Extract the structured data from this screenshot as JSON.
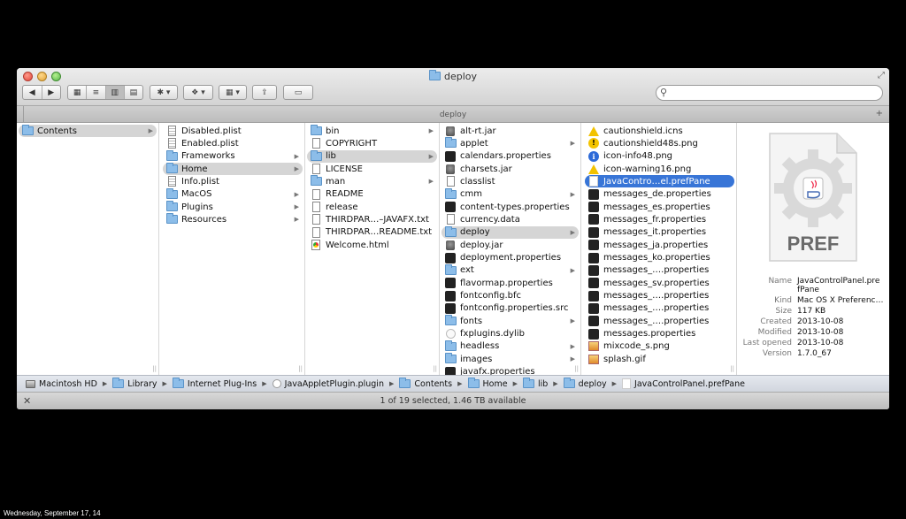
{
  "window": {
    "title": "deploy",
    "tab_label": "deploy",
    "status": "1 of 19 selected, 1.46 TB available"
  },
  "toolbar": {
    "back_label": "◀",
    "forward_label": "▶",
    "view_icons": "▦",
    "view_list": "≡",
    "view_columns": "▥",
    "view_coverflow": "▤",
    "action_label": "✱ ▾",
    "dropbox_label": "❖ ▾",
    "arrange_label": "▦ ▾",
    "share_label": "⇪",
    "toggle_label": "▭",
    "search_placeholder": ""
  },
  "columns": [
    {
      "items": [
        {
          "name": "Contents",
          "icon": "folder",
          "arrow": true,
          "state": "gray"
        }
      ]
    },
    {
      "items": [
        {
          "name": "Disabled.plist",
          "icon": "plist",
          "arrow": false
        },
        {
          "name": "Enabled.plist",
          "icon": "plist",
          "arrow": false
        },
        {
          "name": "Frameworks",
          "icon": "folder",
          "arrow": true
        },
        {
          "name": "Home",
          "icon": "folder",
          "arrow": true,
          "state": "gray"
        },
        {
          "name": "Info.plist",
          "icon": "plist",
          "arrow": false
        },
        {
          "name": "MacOS",
          "icon": "folder",
          "arrow": true
        },
        {
          "name": "Plugins",
          "icon": "folder",
          "arrow": true
        },
        {
          "name": "Resources",
          "icon": "folder",
          "arrow": true
        }
      ]
    },
    {
      "items": [
        {
          "name": "bin",
          "icon": "folder",
          "arrow": true
        },
        {
          "name": "COPYRIGHT",
          "icon": "doc",
          "arrow": false
        },
        {
          "name": "lib",
          "icon": "folder",
          "arrow": true,
          "state": "gray"
        },
        {
          "name": "LICENSE",
          "icon": "doc",
          "arrow": false
        },
        {
          "name": "man",
          "icon": "folder",
          "arrow": true
        },
        {
          "name": "README",
          "icon": "doc",
          "arrow": false
        },
        {
          "name": "release",
          "icon": "doc",
          "arrow": false
        },
        {
          "name": "THIRDPAR…–JAVAFX.txt",
          "icon": "doc",
          "arrow": false
        },
        {
          "name": "THIRDPAR…README.txt",
          "icon": "doc",
          "arrow": false
        },
        {
          "name": "Welcome.html",
          "icon": "html",
          "arrow": false
        }
      ]
    },
    {
      "items": [
        {
          "name": "alt-rt.jar",
          "icon": "jar",
          "arrow": false
        },
        {
          "name": "applet",
          "icon": "folder",
          "arrow": true
        },
        {
          "name": "calendars.properties",
          "icon": "exec",
          "arrow": false
        },
        {
          "name": "charsets.jar",
          "icon": "jar",
          "arrow": false
        },
        {
          "name": "classlist",
          "icon": "doc",
          "arrow": false
        },
        {
          "name": "cmm",
          "icon": "folder",
          "arrow": true
        },
        {
          "name": "content-types.properties",
          "icon": "exec",
          "arrow": false
        },
        {
          "name": "currency.data",
          "icon": "doc",
          "arrow": false
        },
        {
          "name": "deploy",
          "icon": "folder",
          "arrow": true,
          "state": "gray"
        },
        {
          "name": "deploy.jar",
          "icon": "jar",
          "arrow": false
        },
        {
          "name": "deployment.properties",
          "icon": "exec",
          "arrow": false
        },
        {
          "name": "ext",
          "icon": "folder",
          "arrow": true
        },
        {
          "name": "flavormap.properties",
          "icon": "exec",
          "arrow": false
        },
        {
          "name": "fontconfig.bfc",
          "icon": "exec",
          "arrow": false
        },
        {
          "name": "fontconfig.properties.src",
          "icon": "exec",
          "arrow": false
        },
        {
          "name": "fonts",
          "icon": "folder",
          "arrow": true
        },
        {
          "name": "fxplugins.dylib",
          "icon": "dylib",
          "arrow": false
        },
        {
          "name": "headless",
          "icon": "folder",
          "arrow": true
        },
        {
          "name": "images",
          "icon": "folder",
          "arrow": true
        },
        {
          "name": "javafx.properties",
          "icon": "exec",
          "arrow": false
        }
      ]
    },
    {
      "items": [
        {
          "name": "cautionshield.icns",
          "icon": "warn",
          "arrow": false
        },
        {
          "name": "cautionshield48s.png",
          "icon": "warny",
          "arrow": false
        },
        {
          "name": "icon-info48.png",
          "icon": "info",
          "arrow": false
        },
        {
          "name": "icon-warning16.png",
          "icon": "warn",
          "arrow": false
        },
        {
          "name": "JavaContro…el.prefPane",
          "icon": "pref",
          "arrow": false,
          "state": "blue"
        },
        {
          "name": "messages_de.properties",
          "icon": "exec",
          "arrow": false
        },
        {
          "name": "messages_es.properties",
          "icon": "exec",
          "arrow": false
        },
        {
          "name": "messages_fr.properties",
          "icon": "exec",
          "arrow": false
        },
        {
          "name": "messages_it.properties",
          "icon": "exec",
          "arrow": false
        },
        {
          "name": "messages_ja.properties",
          "icon": "exec",
          "arrow": false
        },
        {
          "name": "messages_ko.properties",
          "icon": "exec",
          "arrow": false
        },
        {
          "name": "messages_….properties",
          "icon": "exec",
          "arrow": false
        },
        {
          "name": "messages_sv.properties",
          "icon": "exec",
          "arrow": false
        },
        {
          "name": "messages_….properties",
          "icon": "exec",
          "arrow": false
        },
        {
          "name": "messages_….properties",
          "icon": "exec",
          "arrow": false
        },
        {
          "name": "messages_….properties",
          "icon": "exec",
          "arrow": false
        },
        {
          "name": "messages.properties",
          "icon": "exec",
          "arrow": false
        },
        {
          "name": "mixcode_s.png",
          "icon": "img",
          "arrow": false
        },
        {
          "name": "splash.gif",
          "icon": "img",
          "arrow": false
        }
      ]
    }
  ],
  "preview": {
    "badge_text": "PREF",
    "info": [
      {
        "key": "Name",
        "value": "JavaControlPanel.pre fPane"
      },
      {
        "key": "Kind",
        "value": "Mac OS X Preferenc…"
      },
      {
        "key": "Size",
        "value": "117 KB"
      },
      {
        "key": "Created",
        "value": "2013-10-08"
      },
      {
        "key": "Modified",
        "value": "2013-10-08"
      },
      {
        "key": "Last opened",
        "value": "2013-10-08"
      },
      {
        "key": "Version",
        "value": "1.7.0_67"
      }
    ]
  },
  "pathbar": [
    {
      "label": "Macintosh HD",
      "icon": "hd"
    },
    {
      "label": "Library",
      "icon": "folder"
    },
    {
      "label": "Internet Plug-Ins",
      "icon": "folder"
    },
    {
      "label": "JavaAppletPlugin.plugin",
      "icon": "plugin"
    },
    {
      "label": "Contents",
      "icon": "folder"
    },
    {
      "label": "Home",
      "icon": "folder"
    },
    {
      "label": "lib",
      "icon": "folder"
    },
    {
      "label": "deploy",
      "icon": "folder"
    },
    {
      "label": "JavaControlPanel.prefPane",
      "icon": "pref"
    }
  ],
  "caption": "Wednesday, September 17, 14",
  "colors": {
    "selection_blue": "#3875d7",
    "selection_gray": "#d5d5d5",
    "folder": "#8cbde9"
  }
}
